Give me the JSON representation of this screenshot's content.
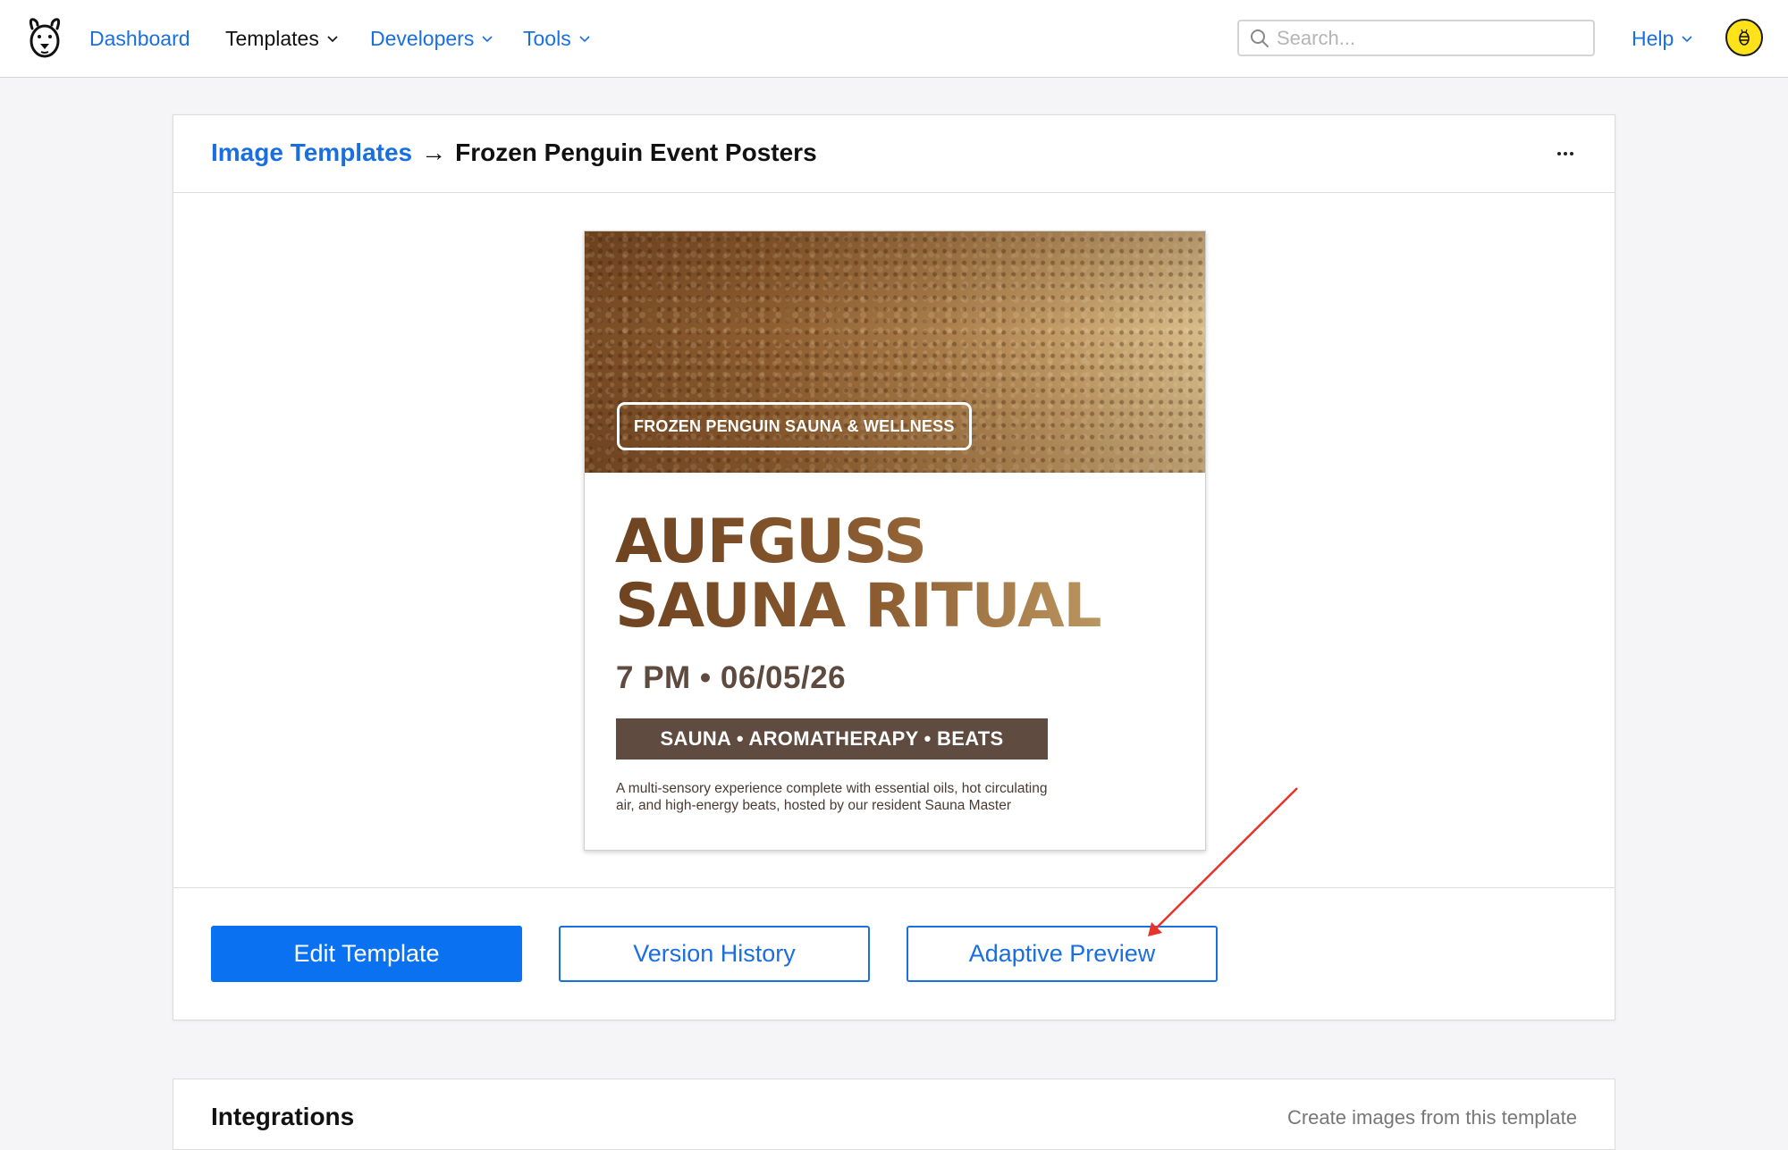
{
  "nav": {
    "dashboard": "Dashboard",
    "templates": "Templates",
    "developers": "Developers",
    "tools": "Tools",
    "help": "Help",
    "search_placeholder": "Search..."
  },
  "breadcrumb": {
    "parent": "Image Templates",
    "separator": "→",
    "current": "Frozen Penguin Event Posters"
  },
  "poster": {
    "badge": "FROZEN PENGUIN SAUNA & WELLNESS",
    "title_line1": "AUFGUSS",
    "title_line2": "SAUNA RITUAL",
    "datetime": "7 PM • 06/05/26",
    "tags": "SAUNA • AROMATHERAPY • BEATS",
    "description_line1": "A multi-sensory experience complete with essential oils, hot circulating",
    "description_line2": "air, and high-energy beats, hosted by our resident Sauna Master"
  },
  "actions": {
    "edit": "Edit Template",
    "version_history": "Version History",
    "adaptive_preview": "Adaptive Preview"
  },
  "integrations": {
    "title": "Integrations",
    "subtitle": "Create images from this template"
  },
  "colors": {
    "link": "#1a6fe0",
    "primary_button": "#0a72f0",
    "avatar": "#ffe21a",
    "annotation_arrow": "#e8332a",
    "poster_tag_bg": "#5f4b40"
  },
  "icons": {
    "logo": "bear-logo-icon",
    "search": "search-icon",
    "chevron": "chevron-down-icon",
    "more": "more-horizontal-icon",
    "avatar": "avatar-bee-icon"
  }
}
